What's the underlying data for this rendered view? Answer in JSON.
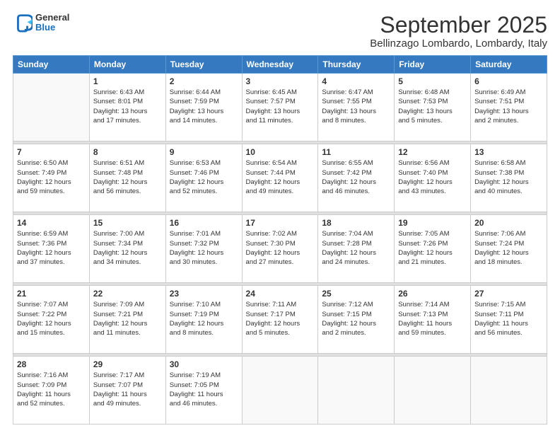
{
  "header": {
    "logo": {
      "general": "General",
      "blue": "Blue"
    },
    "title": "September 2025",
    "location": "Bellinzago Lombardo, Lombardy, Italy"
  },
  "calendar": {
    "days_of_week": [
      "Sunday",
      "Monday",
      "Tuesday",
      "Wednesday",
      "Thursday",
      "Friday",
      "Saturday"
    ],
    "weeks": [
      [
        {
          "day": "",
          "detail": ""
        },
        {
          "day": "1",
          "detail": "Sunrise: 6:43 AM\nSunset: 8:01 PM\nDaylight: 13 hours\nand 17 minutes."
        },
        {
          "day": "2",
          "detail": "Sunrise: 6:44 AM\nSunset: 7:59 PM\nDaylight: 13 hours\nand 14 minutes."
        },
        {
          "day": "3",
          "detail": "Sunrise: 6:45 AM\nSunset: 7:57 PM\nDaylight: 13 hours\nand 11 minutes."
        },
        {
          "day": "4",
          "detail": "Sunrise: 6:47 AM\nSunset: 7:55 PM\nDaylight: 13 hours\nand 8 minutes."
        },
        {
          "day": "5",
          "detail": "Sunrise: 6:48 AM\nSunset: 7:53 PM\nDaylight: 13 hours\nand 5 minutes."
        },
        {
          "day": "6",
          "detail": "Sunrise: 6:49 AM\nSunset: 7:51 PM\nDaylight: 13 hours\nand 2 minutes."
        }
      ],
      [
        {
          "day": "7",
          "detail": "Sunrise: 6:50 AM\nSunset: 7:49 PM\nDaylight: 12 hours\nand 59 minutes."
        },
        {
          "day": "8",
          "detail": "Sunrise: 6:51 AM\nSunset: 7:48 PM\nDaylight: 12 hours\nand 56 minutes."
        },
        {
          "day": "9",
          "detail": "Sunrise: 6:53 AM\nSunset: 7:46 PM\nDaylight: 12 hours\nand 52 minutes."
        },
        {
          "day": "10",
          "detail": "Sunrise: 6:54 AM\nSunset: 7:44 PM\nDaylight: 12 hours\nand 49 minutes."
        },
        {
          "day": "11",
          "detail": "Sunrise: 6:55 AM\nSunset: 7:42 PM\nDaylight: 12 hours\nand 46 minutes."
        },
        {
          "day": "12",
          "detail": "Sunrise: 6:56 AM\nSunset: 7:40 PM\nDaylight: 12 hours\nand 43 minutes."
        },
        {
          "day": "13",
          "detail": "Sunrise: 6:58 AM\nSunset: 7:38 PM\nDaylight: 12 hours\nand 40 minutes."
        }
      ],
      [
        {
          "day": "14",
          "detail": "Sunrise: 6:59 AM\nSunset: 7:36 PM\nDaylight: 12 hours\nand 37 minutes."
        },
        {
          "day": "15",
          "detail": "Sunrise: 7:00 AM\nSunset: 7:34 PM\nDaylight: 12 hours\nand 34 minutes."
        },
        {
          "day": "16",
          "detail": "Sunrise: 7:01 AM\nSunset: 7:32 PM\nDaylight: 12 hours\nand 30 minutes."
        },
        {
          "day": "17",
          "detail": "Sunrise: 7:02 AM\nSunset: 7:30 PM\nDaylight: 12 hours\nand 27 minutes."
        },
        {
          "day": "18",
          "detail": "Sunrise: 7:04 AM\nSunset: 7:28 PM\nDaylight: 12 hours\nand 24 minutes."
        },
        {
          "day": "19",
          "detail": "Sunrise: 7:05 AM\nSunset: 7:26 PM\nDaylight: 12 hours\nand 21 minutes."
        },
        {
          "day": "20",
          "detail": "Sunrise: 7:06 AM\nSunset: 7:24 PM\nDaylight: 12 hours\nand 18 minutes."
        }
      ],
      [
        {
          "day": "21",
          "detail": "Sunrise: 7:07 AM\nSunset: 7:22 PM\nDaylight: 12 hours\nand 15 minutes."
        },
        {
          "day": "22",
          "detail": "Sunrise: 7:09 AM\nSunset: 7:21 PM\nDaylight: 12 hours\nand 11 minutes."
        },
        {
          "day": "23",
          "detail": "Sunrise: 7:10 AM\nSunset: 7:19 PM\nDaylight: 12 hours\nand 8 minutes."
        },
        {
          "day": "24",
          "detail": "Sunrise: 7:11 AM\nSunset: 7:17 PM\nDaylight: 12 hours\nand 5 minutes."
        },
        {
          "day": "25",
          "detail": "Sunrise: 7:12 AM\nSunset: 7:15 PM\nDaylight: 12 hours\nand 2 minutes."
        },
        {
          "day": "26",
          "detail": "Sunrise: 7:14 AM\nSunset: 7:13 PM\nDaylight: 11 hours\nand 59 minutes."
        },
        {
          "day": "27",
          "detail": "Sunrise: 7:15 AM\nSunset: 7:11 PM\nDaylight: 11 hours\nand 56 minutes."
        }
      ],
      [
        {
          "day": "28",
          "detail": "Sunrise: 7:16 AM\nSunset: 7:09 PM\nDaylight: 11 hours\nand 52 minutes."
        },
        {
          "day": "29",
          "detail": "Sunrise: 7:17 AM\nSunset: 7:07 PM\nDaylight: 11 hours\nand 49 minutes."
        },
        {
          "day": "30",
          "detail": "Sunrise: 7:19 AM\nSunset: 7:05 PM\nDaylight: 11 hours\nand 46 minutes."
        },
        {
          "day": "",
          "detail": ""
        },
        {
          "day": "",
          "detail": ""
        },
        {
          "day": "",
          "detail": ""
        },
        {
          "day": "",
          "detail": ""
        }
      ]
    ]
  }
}
